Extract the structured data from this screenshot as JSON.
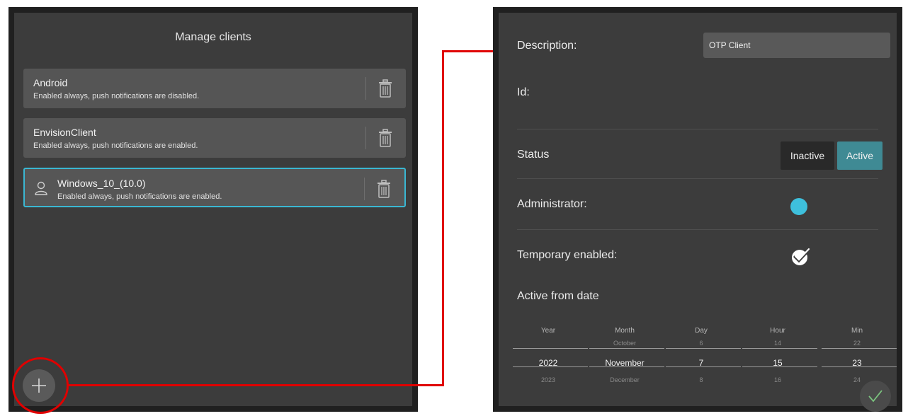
{
  "left": {
    "title": "Manage clients",
    "clients": [
      {
        "name": "Android",
        "status": "Enabled always, push notifications are disabled."
      },
      {
        "name": "EnvisionClient",
        "status": "Enabled always, push notifications are enabled."
      },
      {
        "name": "Windows_10_(10.0)",
        "status": "Enabled always, push notifications are enabled."
      }
    ],
    "add_icon": "plus-icon"
  },
  "right": {
    "description_label": "Description:",
    "description_value": "OTP Client",
    "id_label": "Id:",
    "status_label": "Status",
    "status_options": [
      "Inactive",
      "Active"
    ],
    "status_selected": "Active",
    "administrator_label": "Administrator:",
    "administrator_on": true,
    "temporary_label": "Temporary enabled:",
    "temporary_checked": true,
    "active_from_label": "Active from date",
    "picker": {
      "columns": [
        {
          "label": "Year",
          "prev": "",
          "current": "2022",
          "next": "2023"
        },
        {
          "label": "Month",
          "prev": "October",
          "current": "November",
          "next": "December"
        },
        {
          "label": "Day",
          "prev": "6",
          "current": "7",
          "next": "8"
        },
        {
          "label": "Hour",
          "prev": "14",
          "current": "15",
          "next": "16"
        },
        {
          "label": "Min",
          "prev": "22",
          "current": "23",
          "next": "24"
        }
      ]
    },
    "confirm_icon": "checkmark-icon"
  },
  "colors": {
    "panel_bg": "#3c3c3c",
    "accent_cyan": "#3ec0dc",
    "active_segment": "#3f8a94",
    "annotation_red": "#e00000"
  }
}
